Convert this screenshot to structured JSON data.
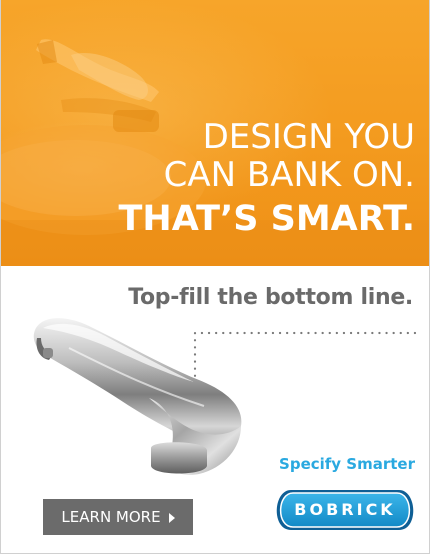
{
  "headline": {
    "line1": "DESIGN YOU",
    "line2": "CAN BANK ON.",
    "line3": "THAT’S SMART."
  },
  "tagline": "Top-fill the bottom line.",
  "cta": {
    "label": "LEARN MORE"
  },
  "brand": {
    "slogan": "Specify Smarter",
    "logo_text": "BOBRICK"
  },
  "colors": {
    "hero_orange": "#f39a1e",
    "slogan_blue": "#2aa9e0",
    "logo_blue": "#1ea0dc",
    "button_gray": "#6b6b6b",
    "tagline_gray": "#6a6a6a"
  },
  "icons": {
    "cta_arrow": "chevron-right-icon",
    "hero_image": "faucet-photo",
    "product_image": "faucet-handle-photo"
  }
}
